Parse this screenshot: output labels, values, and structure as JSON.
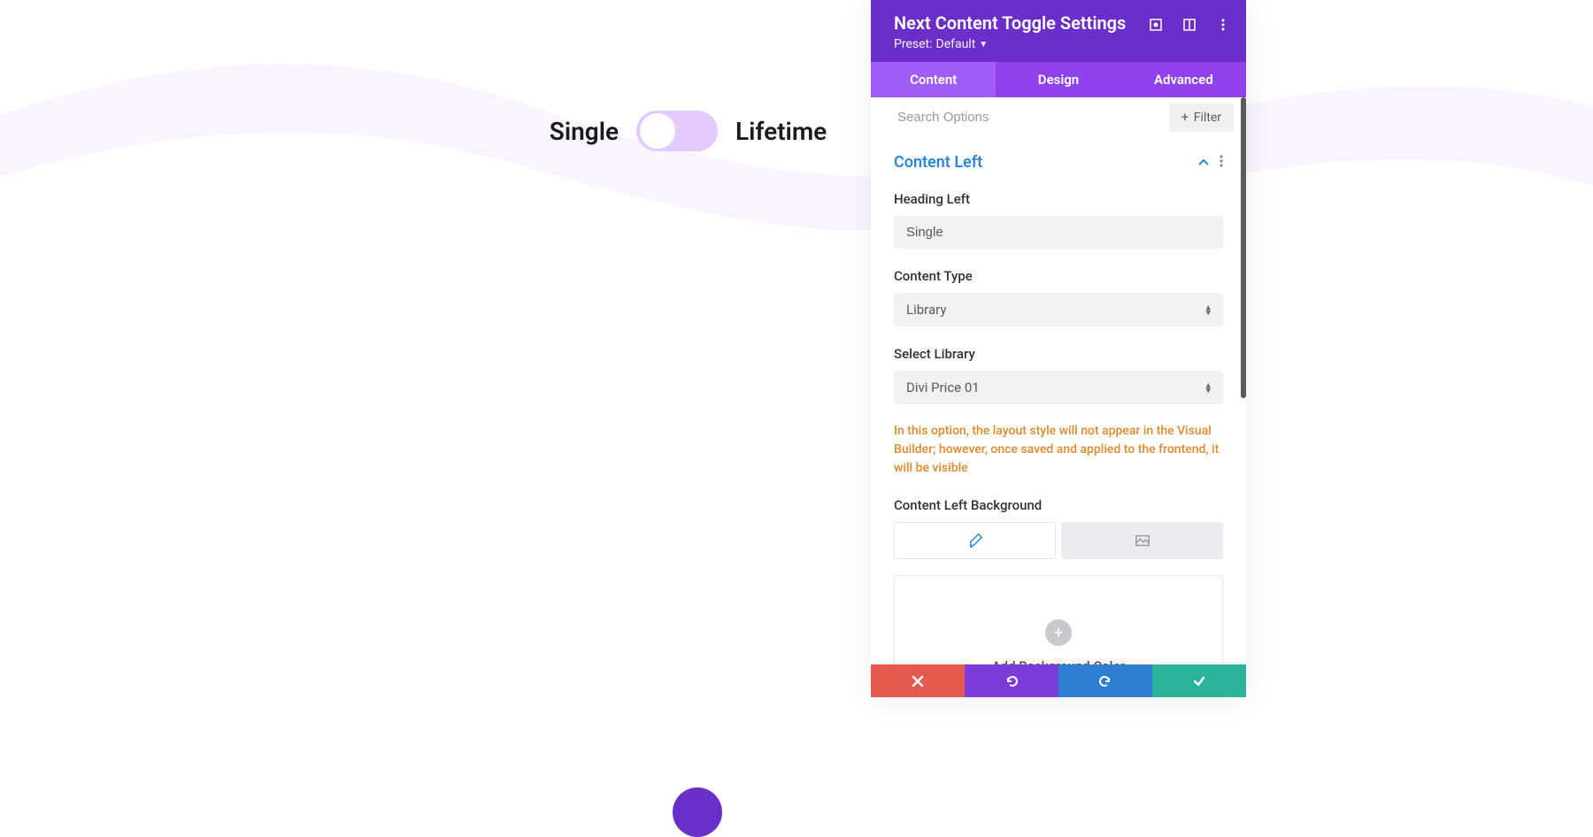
{
  "canvas": {
    "toggle": {
      "left_label": "Single",
      "right_label": "Lifetime"
    }
  },
  "panel": {
    "title": "Next Content Toggle Settings",
    "preset_label": "Preset:",
    "preset_value": "Default",
    "tabs": {
      "content": "Content",
      "design": "Design",
      "advanced": "Advanced"
    },
    "search_placeholder": "Search Options",
    "filter_label": "Filter",
    "section": {
      "title": "Content Left",
      "fields": {
        "heading_left_label": "Heading Left",
        "heading_left_value": "Single",
        "content_type_label": "Content Type",
        "content_type_value": "Library",
        "select_library_label": "Select Library",
        "select_library_value": "Divi Price 01",
        "note": "In this option, the layout style will not appear in the Visual Builder; however, once saved and applied to the frontend, it will be visible",
        "content_bg_label": "Content Left Background",
        "add_bg_label": "Add Background Color"
      }
    }
  }
}
